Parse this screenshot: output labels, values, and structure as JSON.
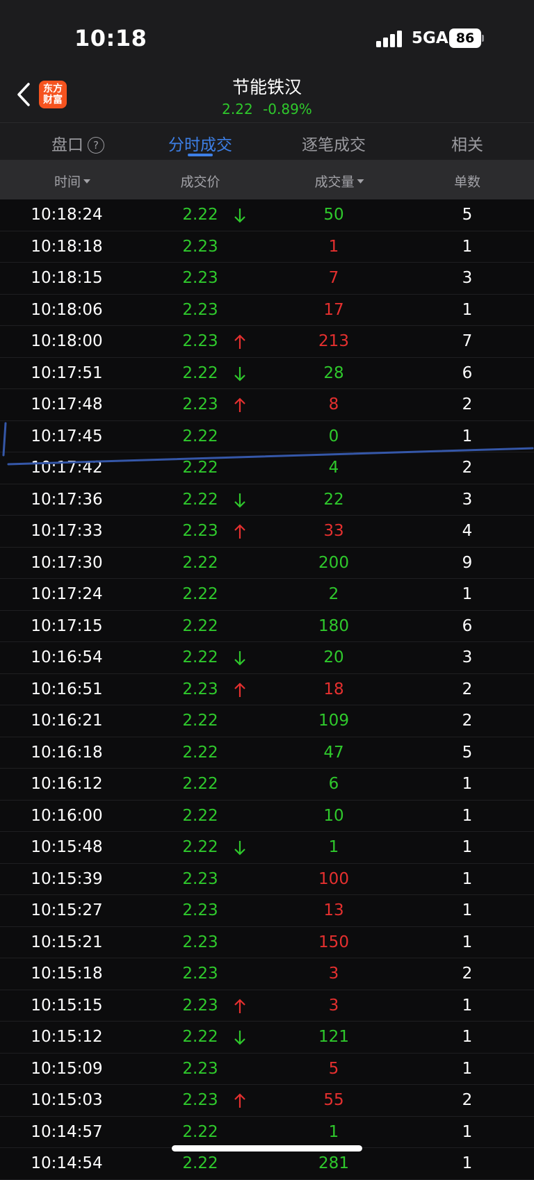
{
  "status": {
    "time": "10:18",
    "network": "5GA",
    "battery": "86"
  },
  "nav": {
    "logo_line1": "东方",
    "logo_line2": "财富",
    "stock_name": "节能铁汉",
    "price": "2.22",
    "change": "-0.89%"
  },
  "tabs": [
    {
      "label": "盘口",
      "help": "?"
    },
    {
      "label": "分时成交"
    },
    {
      "label": "逐笔成交"
    },
    {
      "label": "相关"
    }
  ],
  "columns": {
    "time": "时间",
    "price": "成交价",
    "volume": "成交量",
    "count": "单数"
  },
  "colors": {
    "up": "#e5302f",
    "down": "#2fc92c",
    "accent": "#3d7fe6",
    "brand": "#f5531f"
  },
  "trades": [
    {
      "time": "10:18:24",
      "price": "2.22",
      "arrow": "down",
      "volume": "50",
      "vol_dir": "down",
      "count": "5"
    },
    {
      "time": "10:18:18",
      "price": "2.23",
      "arrow": "",
      "volume": "1",
      "vol_dir": "up",
      "count": "1"
    },
    {
      "time": "10:18:15",
      "price": "2.23",
      "arrow": "",
      "volume": "7",
      "vol_dir": "up",
      "count": "3"
    },
    {
      "time": "10:18:06",
      "price": "2.23",
      "arrow": "",
      "volume": "17",
      "vol_dir": "up",
      "count": "1"
    },
    {
      "time": "10:18:00",
      "price": "2.23",
      "arrow": "up",
      "volume": "213",
      "vol_dir": "up",
      "count": "7"
    },
    {
      "time": "10:17:51",
      "price": "2.22",
      "arrow": "down",
      "volume": "28",
      "vol_dir": "down",
      "count": "6"
    },
    {
      "time": "10:17:48",
      "price": "2.23",
      "arrow": "up",
      "volume": "8",
      "vol_dir": "up",
      "count": "2"
    },
    {
      "time": "10:17:45",
      "price": "2.22",
      "arrow": "",
      "volume": "0",
      "vol_dir": "down",
      "count": "1"
    },
    {
      "time": "10:17:42",
      "price": "2.22",
      "arrow": "",
      "volume": "4",
      "vol_dir": "down",
      "count": "2"
    },
    {
      "time": "10:17:36",
      "price": "2.22",
      "arrow": "down",
      "volume": "22",
      "vol_dir": "down",
      "count": "3"
    },
    {
      "time": "10:17:33",
      "price": "2.23",
      "arrow": "up",
      "volume": "33",
      "vol_dir": "up",
      "count": "4"
    },
    {
      "time": "10:17:30",
      "price": "2.22",
      "arrow": "",
      "volume": "200",
      "vol_dir": "down",
      "count": "9"
    },
    {
      "time": "10:17:24",
      "price": "2.22",
      "arrow": "",
      "volume": "2",
      "vol_dir": "down",
      "count": "1"
    },
    {
      "time": "10:17:15",
      "price": "2.22",
      "arrow": "",
      "volume": "180",
      "vol_dir": "down",
      "count": "6"
    },
    {
      "time": "10:16:54",
      "price": "2.22",
      "arrow": "down",
      "volume": "20",
      "vol_dir": "down",
      "count": "3"
    },
    {
      "time": "10:16:51",
      "price": "2.23",
      "arrow": "up",
      "volume": "18",
      "vol_dir": "up",
      "count": "2"
    },
    {
      "time": "10:16:21",
      "price": "2.22",
      "arrow": "",
      "volume": "109",
      "vol_dir": "down",
      "count": "2"
    },
    {
      "time": "10:16:18",
      "price": "2.22",
      "arrow": "",
      "volume": "47",
      "vol_dir": "down",
      "count": "5"
    },
    {
      "time": "10:16:12",
      "price": "2.22",
      "arrow": "",
      "volume": "6",
      "vol_dir": "down",
      "count": "1"
    },
    {
      "time": "10:16:00",
      "price": "2.22",
      "arrow": "",
      "volume": "10",
      "vol_dir": "down",
      "count": "1"
    },
    {
      "time": "10:15:48",
      "price": "2.22",
      "arrow": "down",
      "volume": "1",
      "vol_dir": "down",
      "count": "1"
    },
    {
      "time": "10:15:39",
      "price": "2.23",
      "arrow": "",
      "volume": "100",
      "vol_dir": "up",
      "count": "1"
    },
    {
      "time": "10:15:27",
      "price": "2.23",
      "arrow": "",
      "volume": "13",
      "vol_dir": "up",
      "count": "1"
    },
    {
      "time": "10:15:21",
      "price": "2.23",
      "arrow": "",
      "volume": "150",
      "vol_dir": "up",
      "count": "1"
    },
    {
      "time": "10:15:18",
      "price": "2.23",
      "arrow": "",
      "volume": "3",
      "vol_dir": "up",
      "count": "2"
    },
    {
      "time": "10:15:15",
      "price": "2.23",
      "arrow": "up",
      "volume": "3",
      "vol_dir": "up",
      "count": "1"
    },
    {
      "time": "10:15:12",
      "price": "2.22",
      "arrow": "down",
      "volume": "121",
      "vol_dir": "down",
      "count": "1"
    },
    {
      "time": "10:15:09",
      "price": "2.23",
      "arrow": "",
      "volume": "5",
      "vol_dir": "up",
      "count": "1"
    },
    {
      "time": "10:15:03",
      "price": "2.23",
      "arrow": "up",
      "volume": "55",
      "vol_dir": "up",
      "count": "2"
    },
    {
      "time": "10:14:57",
      "price": "2.22",
      "arrow": "",
      "volume": "1",
      "vol_dir": "down",
      "count": "1"
    },
    {
      "time": "10:14:54",
      "price": "2.22",
      "arrow": "",
      "volume": "281",
      "vol_dir": "down",
      "count": "1"
    }
  ]
}
